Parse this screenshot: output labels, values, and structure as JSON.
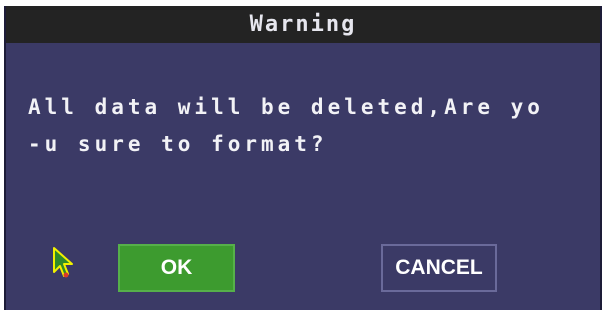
{
  "dialog": {
    "title": "Warning",
    "message_line1": "All data will be deleted,Are yo",
    "message_line2": "-u sure to format?",
    "ok_label": "OK",
    "cancel_label": "CANCEL"
  },
  "icons": {
    "cursor": "mouse-pointer-icon"
  },
  "colors": {
    "dialog_bg": "#3b3a66",
    "titlebar_bg": "#232323",
    "ok_bg": "#3d9b2f",
    "text": "#f2f2f6"
  }
}
